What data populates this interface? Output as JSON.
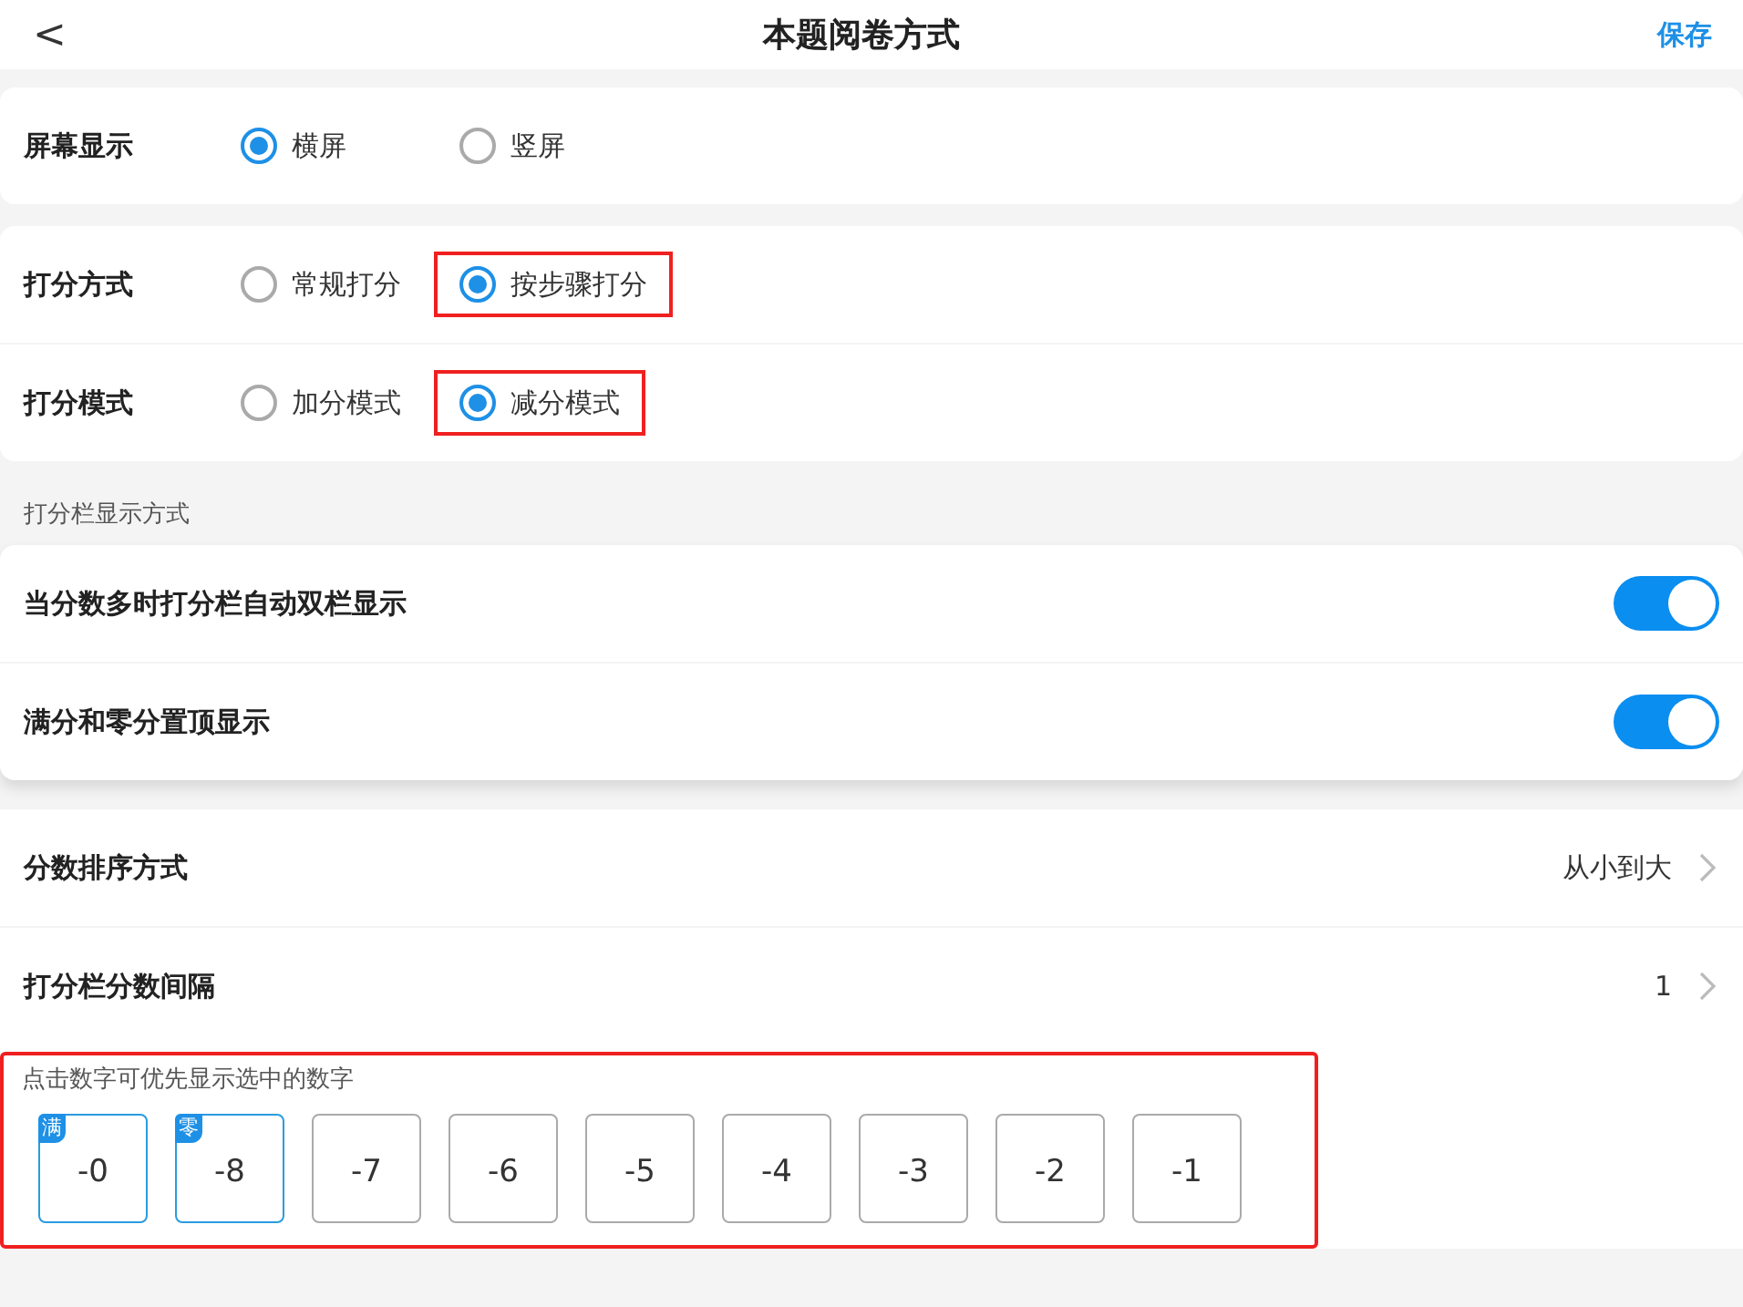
{
  "header": {
    "back": "<",
    "title": "本题阅卷方式",
    "action": "保存"
  },
  "radio_cards": [
    [
      {
        "label": "屏幕显示",
        "options": [
          {
            "label": "横屏",
            "selected": true,
            "highlighted": false
          },
          {
            "label": "竖屏",
            "selected": false,
            "highlighted": false
          }
        ]
      }
    ],
    [
      {
        "label": "打分方式",
        "options": [
          {
            "label": "常规打分",
            "selected": false,
            "highlighted": false
          },
          {
            "label": "按步骤打分",
            "selected": true,
            "highlighted": true
          }
        ]
      },
      {
        "label": "打分模式",
        "options": [
          {
            "label": "加分模式",
            "selected": false,
            "highlighted": false
          },
          {
            "label": "减分模式",
            "selected": true,
            "highlighted": true
          }
        ]
      }
    ]
  ],
  "section_label": "打分栏显示方式",
  "toggles": [
    {
      "label": "当分数多时打分栏自动双栏显示",
      "on": true
    },
    {
      "label": "满分和零分置顶显示",
      "on": true
    }
  ],
  "nav_rows": [
    {
      "label": "分数排序方式",
      "value": "从小到大"
    },
    {
      "label": "打分栏分数间隔",
      "value": "1"
    }
  ],
  "score_panel": {
    "hint": "点击数字可优先显示选中的数字",
    "highlighted": true,
    "scores": [
      {
        "value": "-0",
        "badge": "满",
        "selected": true
      },
      {
        "value": "-8",
        "badge": "零",
        "selected": true
      },
      {
        "value": "-7",
        "selected": false
      },
      {
        "value": "-6",
        "selected": false
      },
      {
        "value": "-5",
        "selected": false
      },
      {
        "value": "-4",
        "selected": false
      },
      {
        "value": "-3",
        "selected": false
      },
      {
        "value": "-2",
        "selected": false
      },
      {
        "value": "-1",
        "selected": false
      }
    ]
  }
}
